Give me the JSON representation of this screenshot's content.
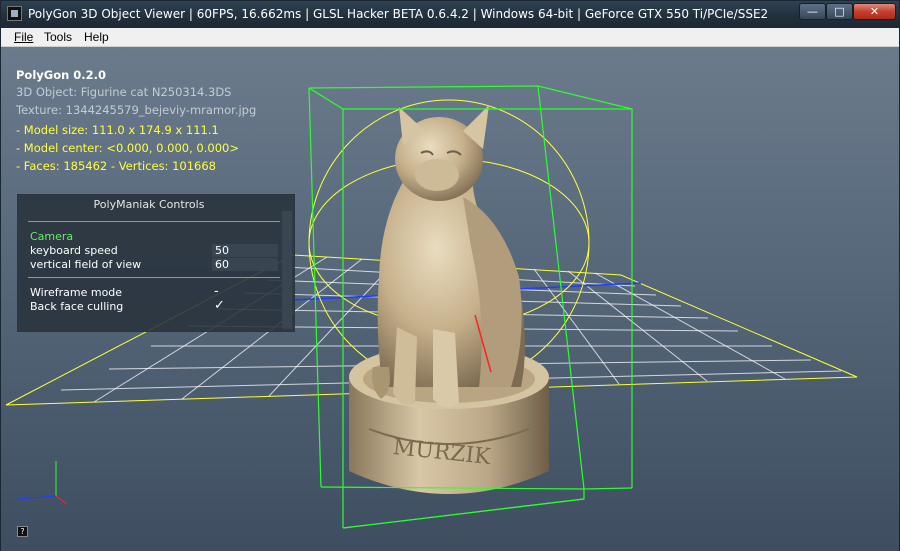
{
  "window": {
    "title": "PolyGon 3D Object Viewer | 60FPS, 16.662ms | GLSL Hacker BETA 0.6.4.2 | Windows 64-bit | GeForce GTX 550 Ti/PCIe/SSE2"
  },
  "menu": {
    "file": "File",
    "tools": "Tools",
    "help": "Help"
  },
  "info": {
    "app_version": "PolyGon 0.2.0",
    "object": "3D Object: Figurine cat N250314.3DS",
    "texture": "Texture: 1344245579_bejeviy-mramor.jpg",
    "model_size": "- Model size:  111.0 x 174.9 x 111.1",
    "model_center": "- Model center:  <0.000, 0.000, 0.000>",
    "faces_vertices": "- Faces: 185462 - Vertices: 101668"
  },
  "controls": {
    "title": "PolyManiak Controls",
    "camera_label": "Camera",
    "keyboard_speed_label": "keyboard speed",
    "keyboard_speed_value": "50",
    "fov_label": "vertical field of view",
    "fov_value": "60",
    "wireframe_label": "Wireframe mode",
    "wireframe_value": "-",
    "backface_label": "Back face culling",
    "backface_value": "✓"
  },
  "model": {
    "engraving": "MURZIK"
  },
  "icons": {
    "help": "?"
  },
  "colors": {
    "bounding_box": "#2cff2c",
    "grid": "#ffffff",
    "grid_border": "#ffff3c",
    "info_highlight": "#ffff3c",
    "camera_label": "#62f062"
  }
}
